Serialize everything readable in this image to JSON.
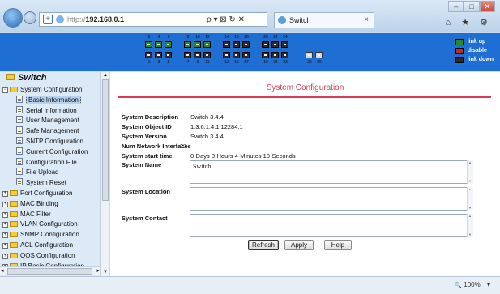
{
  "browser": {
    "url_scheme": "http://",
    "url_host": "192.168.0.1",
    "url_tools": "ρ ▾ ⊠ ↻ ✕",
    "tab_title": "Switch",
    "tab_close": "×",
    "back_glyph": "←",
    "forward_glyph": "→",
    "window_controls": [
      "–",
      "□",
      "✕"
    ],
    "tools": "⌂ ★ ⚙"
  },
  "switch": {
    "port_numbers_top": [
      "2",
      "4",
      "6",
      "8",
      "10",
      "12",
      "14",
      "16",
      "18",
      "20",
      "22",
      "24"
    ],
    "port_numbers_bottom": [
      "1",
      "3",
      "5",
      "7",
      "9",
      "11",
      "13",
      "15",
      "17",
      "19",
      "21",
      "23",
      "25",
      "26"
    ],
    "up_ports": [
      1,
      2,
      3,
      4,
      5,
      6
    ],
    "legend": [
      {
        "label": "link up",
        "color": "#1b8f2a"
      },
      {
        "label": "disable",
        "color": "#c62828"
      },
      {
        "label": "link down",
        "color": "#2b2b2b"
      }
    ]
  },
  "tree": {
    "title": "Switch",
    "items": [
      {
        "label": "System Configuration",
        "type": "folder",
        "expander": "⊟",
        "level": 0
      },
      {
        "label": "Basic Information",
        "type": "page",
        "level": 1,
        "selected": true
      },
      {
        "label": "Serial Information",
        "type": "page",
        "level": 1
      },
      {
        "label": "User Management",
        "type": "page",
        "level": 1
      },
      {
        "label": "Safe Management",
        "type": "page",
        "level": 1
      },
      {
        "label": "SNTP Configuration",
        "type": "page",
        "level": 1
      },
      {
        "label": "Current Configuration",
        "type": "page",
        "level": 1
      },
      {
        "label": "Configuration File",
        "type": "page",
        "level": 1
      },
      {
        "label": "File Upload",
        "type": "page",
        "level": 1
      },
      {
        "label": "System Reset",
        "type": "page",
        "level": 1
      },
      {
        "label": "Port Configuration",
        "type": "folder",
        "expander": "⊞",
        "level": 0
      },
      {
        "label": "MAC Binding",
        "type": "folder",
        "expander": "⊞",
        "level": 0
      },
      {
        "label": "MAC Filter",
        "type": "folder",
        "expander": "⊞",
        "level": 0
      },
      {
        "label": "VLAN Configuration",
        "type": "folder",
        "expander": "⊞",
        "level": 0
      },
      {
        "label": "SNMP Configuration",
        "type": "folder",
        "expander": "⊞",
        "level": 0
      },
      {
        "label": "ACL Configuration",
        "type": "folder",
        "expander": "⊞",
        "level": 0
      },
      {
        "label": "QOS Configuration",
        "type": "folder",
        "expander": "⊞",
        "level": 0
      },
      {
        "label": "IP Basic Configuration",
        "type": "folder",
        "expander": "⊞",
        "level": 0
      }
    ],
    "scroll_up": "▲",
    "scroll_down": "▼",
    "scroll_left": "◂",
    "scroll_right": "▸"
  },
  "main": {
    "title": "System Configuration",
    "fields": [
      {
        "label": "System Description",
        "value": "Switch 3.4.4"
      },
      {
        "label": "System Object ID",
        "value": "1.3.6.1.4.1.12284.1"
      },
      {
        "label": "System Version",
        "value": "Switch 3.4.4"
      },
      {
        "label": "Num Network Interfaces",
        "value": "27"
      },
      {
        "label": "System start time",
        "value": "0-Days 0-Hours 4-Minutes 10-Seconds"
      }
    ],
    "system_name_label": "System Name",
    "system_name_value": "Switch",
    "system_location_label": "System Location",
    "system_location_value": "",
    "system_contact_label": "System Contact",
    "system_contact_value": "",
    "buttons": {
      "refresh": "Refresh",
      "apply": "Apply",
      "help": "Help"
    }
  },
  "status": {
    "zoom": "100%",
    "zoom_icon": "🔍",
    "zoom_arrow": "▾"
  }
}
